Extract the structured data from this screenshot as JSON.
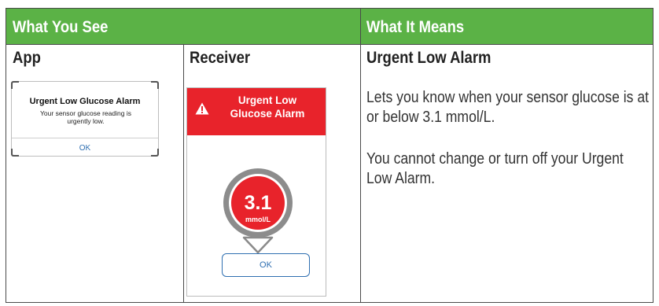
{
  "header": {
    "what_you_see": "What You See",
    "what_it_means": "What It Means"
  },
  "app": {
    "column_title": "App",
    "dialog": {
      "title": "Urgent Low Glucose Alarm",
      "message": "Your sensor glucose reading is urgently low.",
      "ok_label": "OK"
    }
  },
  "receiver": {
    "column_title": "Receiver",
    "alert_title_line1": "Urgent Low",
    "alert_title_line2": "Glucose Alarm",
    "reading_value": "3.1",
    "reading_unit": "mmol/L",
    "ok_label": "OK",
    "icon": "warning-triangle-icon",
    "alert_color": "#e8232b"
  },
  "means": {
    "title": "Urgent Low Alarm",
    "paragraphs": [
      "Lets you know when your sensor glucose is at or below 3.1 mmol/L.",
      "You cannot change or turn off your Urgent Low Alarm."
    ]
  },
  "colors": {
    "header_green": "#5bb246",
    "link_blue": "#2f6fb1"
  }
}
